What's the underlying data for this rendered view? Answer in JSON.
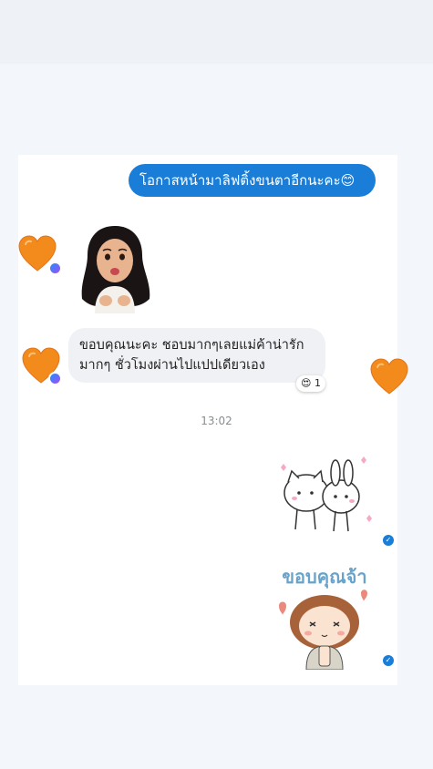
{
  "conversation": {
    "outgoing_message": "โอกาสหน้ามาลิฟติ้งขนตาอีกนะคะ😊",
    "incoming_message": {
      "line1": "ขอบคุณนะคะ ชอบมากๆเลยแม่ค้าน่ารัก",
      "line2": "มากๆ ชั่วโมงผ่านไปแปปเดียวเอง"
    },
    "reaction": {
      "emoji": "😍",
      "count": "1"
    },
    "timestamp": "13:02",
    "sticker_text": "ขอบคุณจ้า"
  },
  "colors": {
    "accent": "#1a7ed8",
    "incoming_bubble": "#f0f1f4",
    "heart": "#f28a1c"
  },
  "icons": [
    "orange-heart-icon",
    "messenger-badge-icon",
    "seen-check-icon"
  ]
}
